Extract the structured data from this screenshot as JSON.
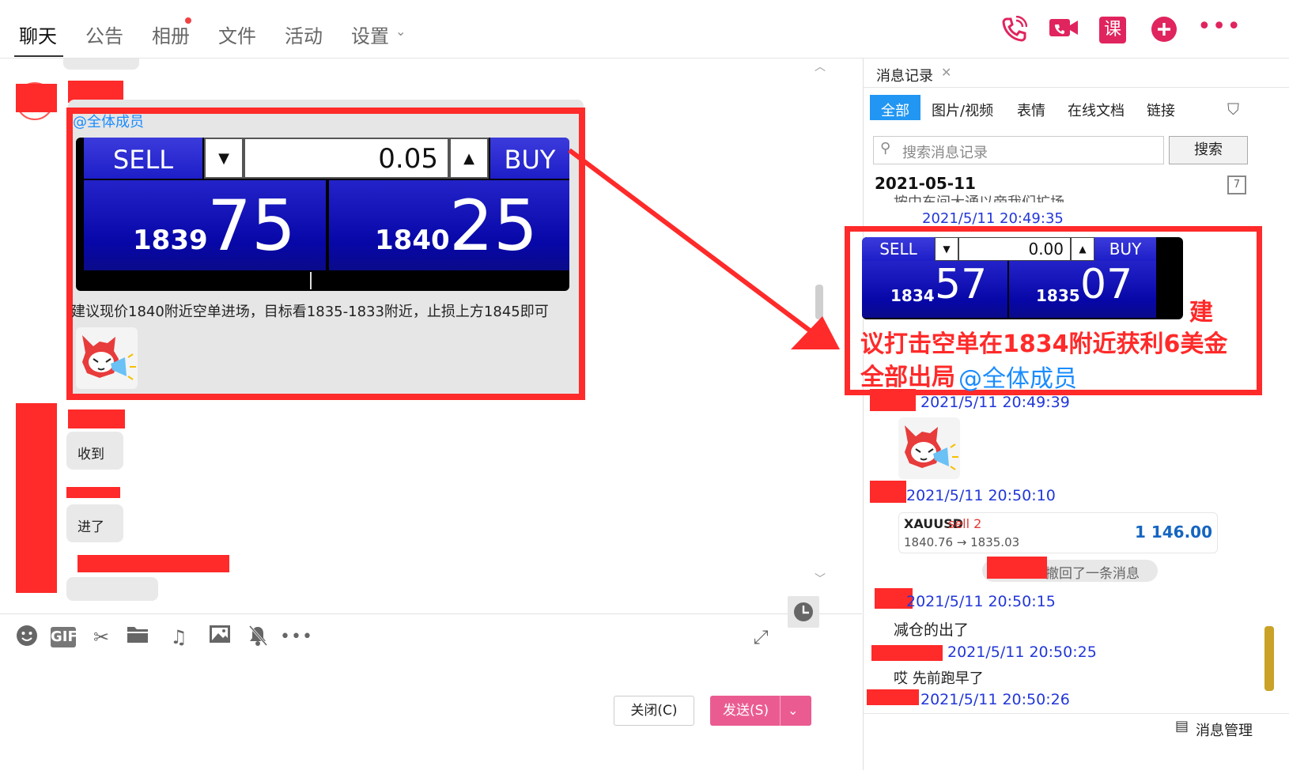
{
  "nav": {
    "tabs": [
      "聊天",
      "公告",
      "相册",
      "文件",
      "活动",
      "设置"
    ],
    "active": "聊天"
  },
  "top_icons": [
    "phone-icon",
    "video-icon",
    "course-icon",
    "plus-icon",
    "more-icon"
  ],
  "top_icon_labels": {
    "course": "课"
  },
  "chat": {
    "mention": "@全体成员",
    "trade_widget": {
      "sell_label": "SELL",
      "buy_label": "BUY",
      "volume": "0.05",
      "sell_price_big": "1839",
      "sell_price_pips": "75",
      "buy_price_big": "1840",
      "buy_price_pips": "25"
    },
    "recommend_text": "建议现价1840附近空单进场，目标看1835-1833附近，止损上方1845即可",
    "reply1": "收到",
    "reply2": "进了"
  },
  "toolbar": {
    "icons": [
      "emoji-icon",
      "gif-icon",
      "scissors-icon",
      "folder-icon",
      "music-icon",
      "image-icon",
      "bell-mute-icon",
      "more-icon"
    ],
    "gif_label": "GIF",
    "close_label": "关闭(C)",
    "send_label": "发送(S)"
  },
  "history": {
    "panel_title": "消息记录",
    "filter_tabs": [
      "全部",
      "图片/视频",
      "表情",
      "在线文档",
      "链接"
    ],
    "search_placeholder": "搜索消息记录",
    "search_button": "搜索",
    "date": "2021-05-11",
    "cut_text": "按中东间大通以帝我们扩场",
    "ts1": "2021/5/11 20:49:35",
    "trade_widget": {
      "sell_label": "SELL",
      "buy_label": "BUY",
      "volume": "0.00",
      "sell_price_big": "1834",
      "sell_price_pips": "57",
      "buy_price_big": "1835",
      "buy_price_pips": "07"
    },
    "big_msg_line1": "建",
    "big_msg_line2": "议打击空单在1834附近获利6美金",
    "big_msg_line3": "全部出局",
    "big_msg_mention": "@全体成员",
    "ts2": "2021/5/11 20:49:39",
    "ts3": "2021/5/11 20:50:10",
    "order_card": {
      "symbol": "XAUUSD",
      "side": "sell 2",
      "prices": "1840.76 → 1835.03",
      "profit": "1 146.00"
    },
    "recall_text": "撤回了一条消息",
    "ts4": "2021/5/11 20:50:15",
    "msg4": "减仓的出了",
    "ts5": "2021/5/11 20:50:25",
    "msg5": "哎 先前跑早了",
    "ts6": "2021/5/11 20:50:26",
    "manage_label": "消息管理"
  },
  "colors": {
    "accent_red": "#ff2a2a",
    "link_blue": "#1a8cff",
    "send_pink": "#ea5c91",
    "tab_blue": "#2196f3"
  }
}
